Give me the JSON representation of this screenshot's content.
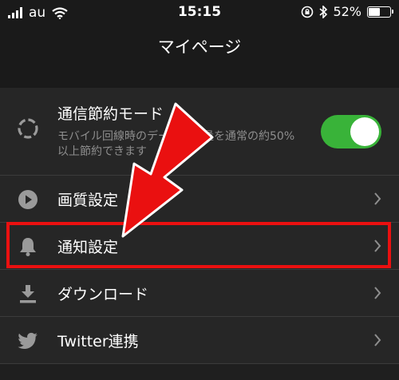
{
  "status_bar": {
    "carrier": "au",
    "time": "15:15",
    "battery_percent": "52%",
    "battery_level": 0.52
  },
  "header": {
    "title": "マイページ"
  },
  "settings": {
    "data_saver": {
      "label": "通信節約モード",
      "description": "モバイル回線時のデータ通信量を通常の約50%以上節約できます",
      "enabled": true
    },
    "items": [
      {
        "label": "画質設定",
        "icon": "play-circle-icon"
      },
      {
        "label": "通知設定",
        "icon": "bell-icon"
      },
      {
        "label": "ダウンロード",
        "icon": "download-icon"
      },
      {
        "label": "Twitter連携",
        "icon": "twitter-icon"
      }
    ]
  },
  "colors": {
    "toggle_on": "#39b339",
    "highlight": "#ea1010",
    "background": "#262626"
  }
}
